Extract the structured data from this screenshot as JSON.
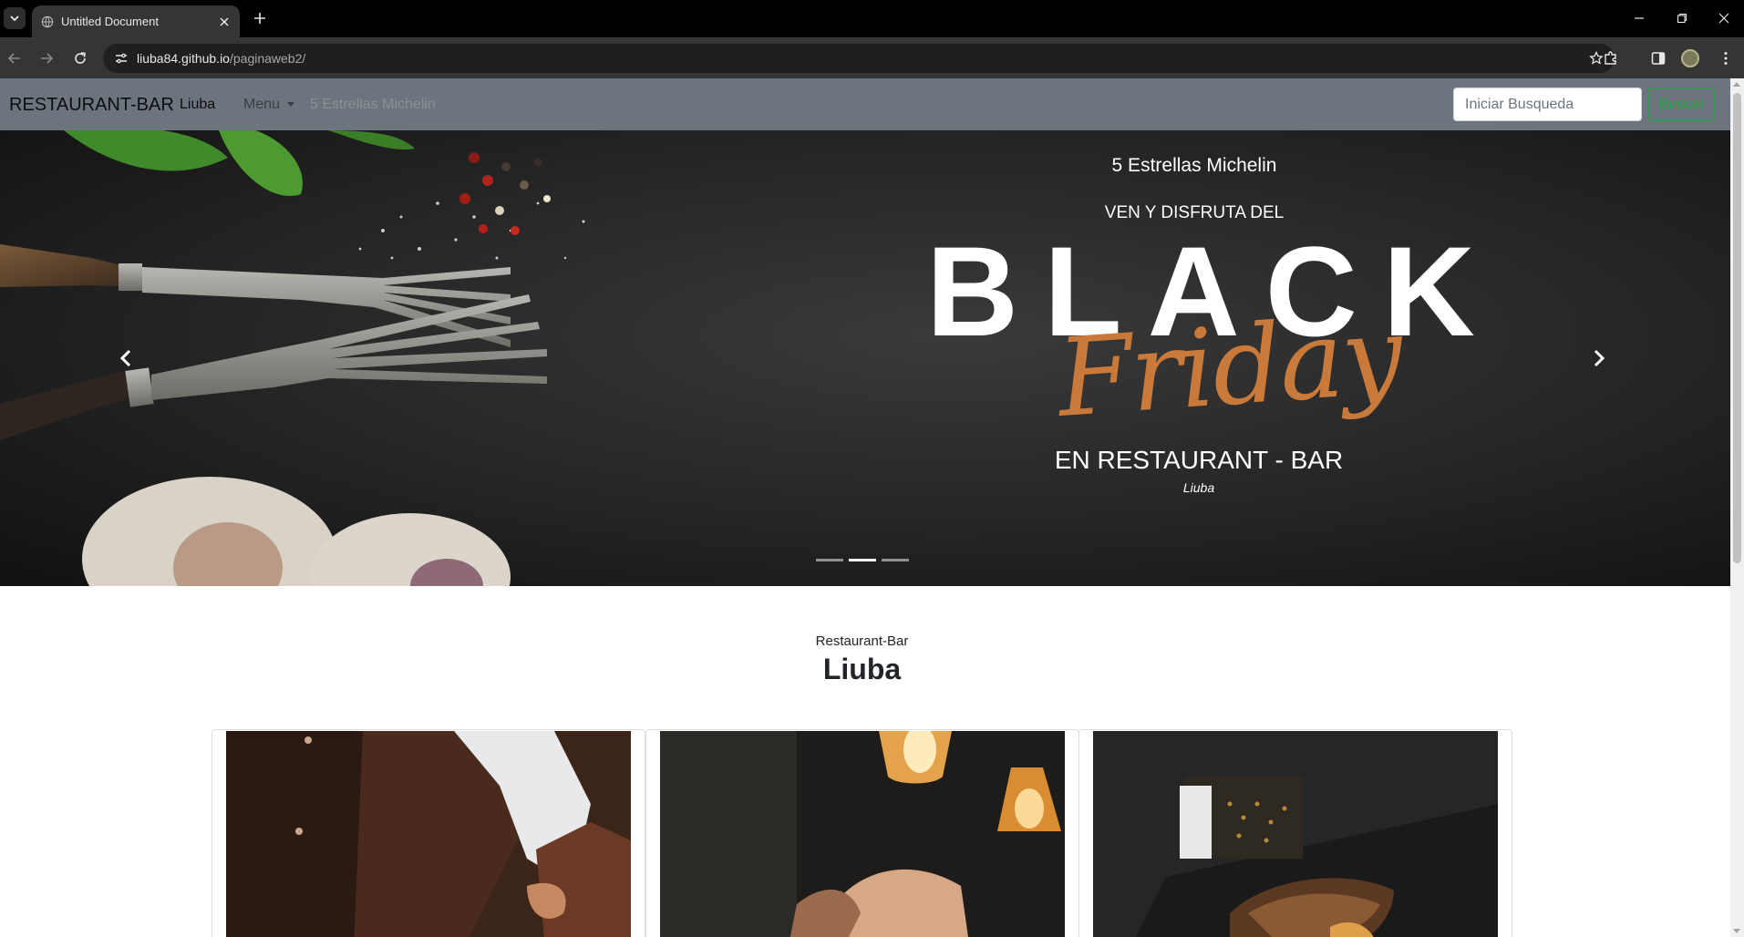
{
  "browser": {
    "tab_title": "Untitled Document",
    "url_host": "liuba84.github.io",
    "url_path": "/paginaweb2/"
  },
  "navbar": {
    "brand": "RESTAURANT-BAR",
    "links": [
      "Liuba",
      "Menu",
      "5 Estrellas Michelin"
    ],
    "search_placeholder": "Iniciar Busqueda",
    "search_button": "Buscar"
  },
  "carousel": {
    "caption_top": "5 Estrellas Michelin",
    "caption_sub": "VEN Y DISFRUTA DEL",
    "promo_word_1": "BLACK",
    "promo_word_2": "Friday",
    "caption_main": "EN RESTAURANT - BAR",
    "caption_small": "Liuba",
    "slides_count": 3,
    "active_slide": 1
  },
  "section": {
    "subtitle": "Restaurant-Bar",
    "title": "Liuba"
  },
  "cards": [
    {
      "image": "chef-apron-photo"
    },
    {
      "image": "bar-lamps-photo"
    },
    {
      "image": "dessert-grater-photo"
    }
  ],
  "colors": {
    "navbar_bg": "#6c757d",
    "search_button": "#28a745",
    "friday_gold": "#c97a3a"
  }
}
